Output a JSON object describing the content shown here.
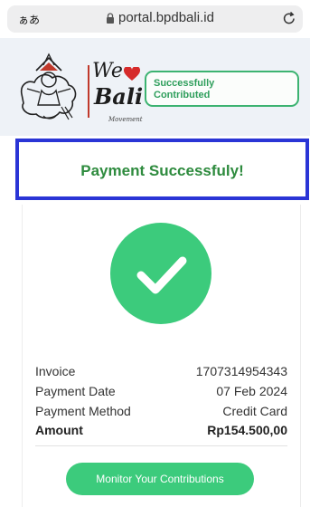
{
  "browser": {
    "text_size_label": "ぁあ",
    "url": "portal.bpdbali.id"
  },
  "header": {
    "logo": {
      "we": "We",
      "bali": "Bali",
      "movement": "Movement"
    },
    "badge_line1": "Successfully",
    "badge_line2": "Contributed"
  },
  "banner": {
    "title": "Payment Successfuly!"
  },
  "details": [
    {
      "label": "Invoice",
      "value": "1707314954343"
    },
    {
      "label": "Payment Date",
      "value": "07 Feb 2024"
    },
    {
      "label": "Payment Method",
      "value": "Credit Card"
    },
    {
      "label": "Amount",
      "value": "Rp154.500,00"
    }
  ],
  "cta": {
    "label": "Monitor Your Contributions"
  },
  "colors": {
    "success_green": "#3ccb7c",
    "banner_border": "#2a35d6",
    "title_green": "#2e8b3e"
  }
}
